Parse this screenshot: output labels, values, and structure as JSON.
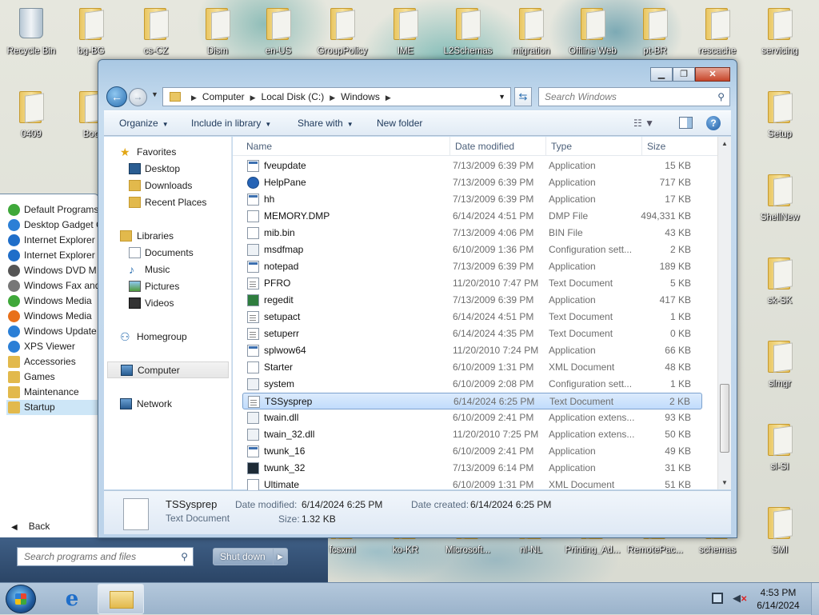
{
  "desktop": {
    "icons": [
      {
        "label": "Recycle Bin",
        "kind": "bin"
      },
      {
        "label": "bg-BG",
        "kind": "folder"
      },
      {
        "label": "cs-CZ",
        "kind": "folder"
      },
      {
        "label": "Dism",
        "kind": "folder"
      },
      {
        "label": "en-US",
        "kind": "folder"
      },
      {
        "label": "GroupPolicy",
        "kind": "folder"
      },
      {
        "label": "IME",
        "kind": "folder"
      },
      {
        "label": "L2Schemas",
        "kind": "folder"
      },
      {
        "label": "migration",
        "kind": "folder"
      },
      {
        "label": "Offline Web",
        "kind": "folder"
      },
      {
        "label": "pt-BR",
        "kind": "folder"
      },
      {
        "label": "rescache",
        "kind": "folder"
      },
      {
        "label": "servicing",
        "kind": "folder"
      },
      {
        "label": "0409",
        "kind": "folder"
      },
      {
        "label": "Boo",
        "kind": "folder"
      },
      {
        "label": "Setup",
        "kind": "folder"
      },
      {
        "label": "ShellNew",
        "kind": "folder"
      },
      {
        "label": "sk-SK",
        "kind": "folder"
      },
      {
        "label": "slmgr",
        "kind": "folder"
      },
      {
        "label": "sl-SI",
        "kind": "folder"
      },
      {
        "label": "SMI",
        "kind": "folder"
      },
      {
        "label": "schemas",
        "kind": "folder"
      },
      {
        "label": "RemotePac...",
        "kind": "folder"
      },
      {
        "label": "Printing_Ad...",
        "kind": "folder"
      },
      {
        "label": "nl-NL",
        "kind": "folder"
      },
      {
        "label": "Microsoft...",
        "kind": "folder"
      },
      {
        "label": "ko-KR",
        "kind": "folder"
      },
      {
        "label": "fcsxml",
        "kind": "folder"
      }
    ]
  },
  "start_menu": {
    "items": [
      {
        "label": "Default Programs",
        "icon": "default-programs-icon",
        "color": "#3fa83a"
      },
      {
        "label": "Desktop Gadget G",
        "icon": "gadget-icon",
        "color": "#2b7fd6"
      },
      {
        "label": "Internet Explorer",
        "icon": "ie-icon",
        "color": "#1f6ec9"
      },
      {
        "label": "Internet Explorer",
        "icon": "ie-icon",
        "color": "#1f6ec9"
      },
      {
        "label": "Windows DVD M",
        "icon": "dvd-icon",
        "color": "#555555"
      },
      {
        "label": "Windows Fax and",
        "icon": "fax-icon",
        "color": "#777777"
      },
      {
        "label": "Windows Media",
        "icon": "media-center-icon",
        "color": "#3fa83a"
      },
      {
        "label": "Windows Media",
        "icon": "media-player-icon",
        "color": "#e8701a"
      },
      {
        "label": "Windows Update",
        "icon": "update-icon",
        "color": "#2b7fd6"
      },
      {
        "label": "XPS Viewer",
        "icon": "xps-icon",
        "color": "#2b7fd6"
      },
      {
        "label": "Accessories",
        "icon": "folder-icon",
        "color": "#e2b94c"
      },
      {
        "label": "Games",
        "icon": "folder-icon",
        "color": "#e2b94c"
      },
      {
        "label": "Maintenance",
        "icon": "folder-icon",
        "color": "#e2b94c"
      },
      {
        "label": "Startup",
        "icon": "folder-icon",
        "color": "#e2b94c"
      }
    ],
    "back_label": "Back",
    "search_placeholder": "Search programs and files",
    "shutdown_label": "Shut down"
  },
  "explorer": {
    "address": {
      "parts": [
        "Computer",
        "Local Disk (C:)",
        "Windows"
      ]
    },
    "search_placeholder": "Search Windows",
    "toolbar": {
      "organize": "Organize",
      "include_library": "Include in library",
      "share_with": "Share with",
      "new_folder": "New folder"
    },
    "nav": {
      "favorites": "Favorites",
      "desktop": "Desktop",
      "downloads": "Downloads",
      "recent_places": "Recent Places",
      "libraries": "Libraries",
      "documents": "Documents",
      "music": "Music",
      "pictures": "Pictures",
      "videos": "Videos",
      "homegroup": "Homegroup",
      "computer": "Computer",
      "network": "Network"
    },
    "columns": {
      "name": "Name",
      "date": "Date modified",
      "type": "Type",
      "size": "Size"
    },
    "files": [
      {
        "name": "fveupdate",
        "date": "7/13/2009 6:39 PM",
        "type": "Application",
        "size": "15 KB",
        "icon": "app"
      },
      {
        "name": "HelpPane",
        "date": "7/13/2009 6:39 PM",
        "type": "Application",
        "size": "717 KB",
        "icon": "help"
      },
      {
        "name": "hh",
        "date": "7/13/2009 6:39 PM",
        "type": "Application",
        "size": "17 KB",
        "icon": "app"
      },
      {
        "name": "MEMORY.DMP",
        "date": "6/14/2024 4:51 PM",
        "type": "DMP File",
        "size": "494,331 KB",
        "icon": "blank"
      },
      {
        "name": "mib.bin",
        "date": "7/13/2009 4:06 PM",
        "type": "BIN File",
        "size": "43 KB",
        "icon": "blank"
      },
      {
        "name": "msdfmap",
        "date": "6/10/2009 1:36 PM",
        "type": "Configuration sett...",
        "size": "2 KB",
        "icon": "sys"
      },
      {
        "name": "notepad",
        "date": "7/13/2009 6:39 PM",
        "type": "Application",
        "size": "189 KB",
        "icon": "app"
      },
      {
        "name": "PFRO",
        "date": "11/20/2010 7:47 PM",
        "type": "Text Document",
        "size": "5 KB",
        "icon": "txt"
      },
      {
        "name": "regedit",
        "date": "7/13/2009 6:39 PM",
        "type": "Application",
        "size": "417 KB",
        "icon": "reg"
      },
      {
        "name": "setupact",
        "date": "6/14/2024 4:51 PM",
        "type": "Text Document",
        "size": "1 KB",
        "icon": "txt"
      },
      {
        "name": "setuperr",
        "date": "6/14/2024 4:35 PM",
        "type": "Text Document",
        "size": "0 KB",
        "icon": "txt"
      },
      {
        "name": "splwow64",
        "date": "11/20/2010 7:24 PM",
        "type": "Application",
        "size": "66 KB",
        "icon": "app"
      },
      {
        "name": "Starter",
        "date": "6/10/2009 1:31 PM",
        "type": "XML Document",
        "size": "48 KB",
        "icon": "blank"
      },
      {
        "name": "system",
        "date": "6/10/2009 2:08 PM",
        "type": "Configuration sett...",
        "size": "1 KB",
        "icon": "sys"
      },
      {
        "name": "TSSysprep",
        "date": "6/14/2024 6:25 PM",
        "type": "Text Document",
        "size": "2 KB",
        "icon": "txt",
        "selected": true
      },
      {
        "name": "twain.dll",
        "date": "6/10/2009 2:41 PM",
        "type": "Application extens...",
        "size": "93 KB",
        "icon": "sys"
      },
      {
        "name": "twain_32.dll",
        "date": "11/20/2010 7:25 PM",
        "type": "Application extens...",
        "size": "50 KB",
        "icon": "sys"
      },
      {
        "name": "twunk_16",
        "date": "6/10/2009 2:41 PM",
        "type": "Application",
        "size": "49 KB",
        "icon": "app"
      },
      {
        "name": "twunk_32",
        "date": "7/13/2009 6:14 PM",
        "type": "Application",
        "size": "31 KB",
        "icon": "dos"
      },
      {
        "name": "Ultimate",
        "date": "6/10/2009 1:31 PM",
        "type": "XML Document",
        "size": "51 KB",
        "icon": "blank"
      }
    ],
    "details": {
      "name": "TSSysprep",
      "type": "Text Document",
      "date_modified_label": "Date modified:",
      "date_modified": "6/14/2024 6:25 PM",
      "date_created_label": "Date created:",
      "date_created": "6/14/2024 6:25 PM",
      "size_label": "Size:",
      "size": "1.32 KB"
    }
  },
  "taskbar": {
    "time": "4:53 PM",
    "date": "6/14/2024"
  }
}
